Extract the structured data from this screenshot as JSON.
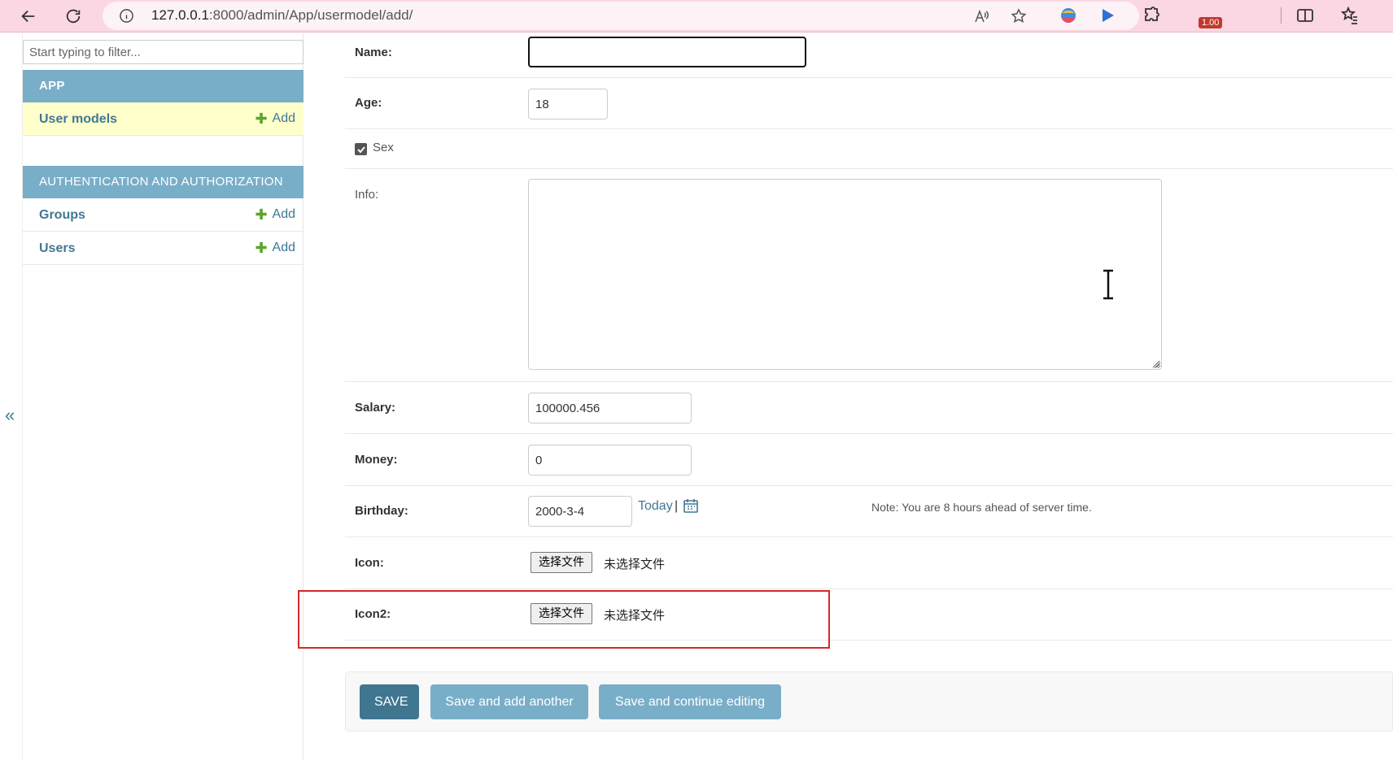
{
  "browser": {
    "url_host": "127.0.0.1",
    "url_rest": ":8000/admin/App/usermodel/add/",
    "badge_value": "1.00"
  },
  "sidebar": {
    "filter_placeholder": "Start typing to filter...",
    "collapse_glyph": "«",
    "modules": [
      {
        "caption": "APP",
        "models": [
          {
            "name": "User models",
            "add": "Add",
            "current": true
          }
        ]
      },
      {
        "caption": "AUTHENTICATION AND AUTHORIZATION",
        "models": [
          {
            "name": "Groups",
            "add": "Add"
          },
          {
            "name": "Users",
            "add": "Add"
          }
        ]
      }
    ],
    "plus_glyph": "✚"
  },
  "form": {
    "name": {
      "label": "Name:",
      "value": ""
    },
    "age": {
      "label": "Age:",
      "value": "18"
    },
    "sex": {
      "label": "Sex",
      "checked": true
    },
    "info": {
      "label": "Info:",
      "value": ""
    },
    "salary": {
      "label": "Salary:",
      "value": "100000.456"
    },
    "money": {
      "label": "Money:",
      "value": "0"
    },
    "birthday": {
      "label": "Birthday:",
      "value": "2000-3-4",
      "today_link": "Today",
      "separator": "|",
      "note": "Note: You are 8 hours ahead of server time."
    },
    "icon": {
      "label": "Icon:",
      "button": "选择文件",
      "status": "未选择文件"
    },
    "icon2": {
      "label": "Icon2:",
      "button": "选择文件",
      "status": "未选择文件"
    }
  },
  "submit": {
    "save": "SAVE",
    "save_add_another": "Save and add another",
    "save_continue": "Save and continue editing"
  },
  "colors": {
    "header_bar": "#fbd6e3",
    "module_caption": "#79aec8",
    "primary_button": "#417690",
    "link": "#417893",
    "highlight": "#d62828"
  }
}
